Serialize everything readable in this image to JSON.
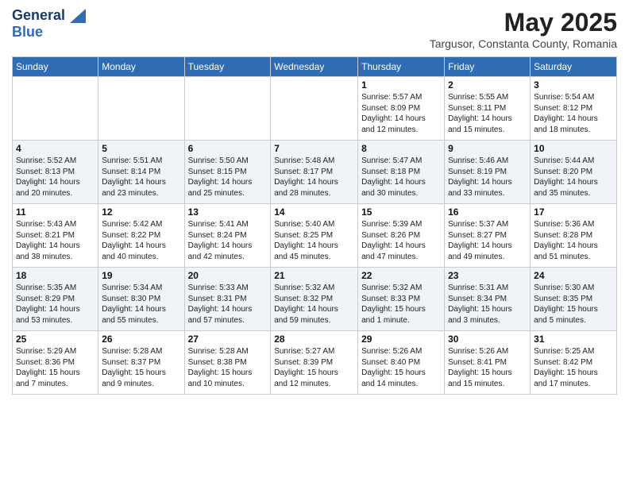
{
  "header": {
    "logo_line1": "General",
    "logo_line2": "Blue",
    "month_title": "May 2025",
    "location": "Targusor, Constanta County, Romania"
  },
  "days_of_week": [
    "Sunday",
    "Monday",
    "Tuesday",
    "Wednesday",
    "Thursday",
    "Friday",
    "Saturday"
  ],
  "weeks": [
    [
      {
        "day": "",
        "info": ""
      },
      {
        "day": "",
        "info": ""
      },
      {
        "day": "",
        "info": ""
      },
      {
        "day": "",
        "info": ""
      },
      {
        "day": "1",
        "info": "Sunrise: 5:57 AM\nSunset: 8:09 PM\nDaylight: 14 hours\nand 12 minutes."
      },
      {
        "day": "2",
        "info": "Sunrise: 5:55 AM\nSunset: 8:11 PM\nDaylight: 14 hours\nand 15 minutes."
      },
      {
        "day": "3",
        "info": "Sunrise: 5:54 AM\nSunset: 8:12 PM\nDaylight: 14 hours\nand 18 minutes."
      }
    ],
    [
      {
        "day": "4",
        "info": "Sunrise: 5:52 AM\nSunset: 8:13 PM\nDaylight: 14 hours\nand 20 minutes."
      },
      {
        "day": "5",
        "info": "Sunrise: 5:51 AM\nSunset: 8:14 PM\nDaylight: 14 hours\nand 23 minutes."
      },
      {
        "day": "6",
        "info": "Sunrise: 5:50 AM\nSunset: 8:15 PM\nDaylight: 14 hours\nand 25 minutes."
      },
      {
        "day": "7",
        "info": "Sunrise: 5:48 AM\nSunset: 8:17 PM\nDaylight: 14 hours\nand 28 minutes."
      },
      {
        "day": "8",
        "info": "Sunrise: 5:47 AM\nSunset: 8:18 PM\nDaylight: 14 hours\nand 30 minutes."
      },
      {
        "day": "9",
        "info": "Sunrise: 5:46 AM\nSunset: 8:19 PM\nDaylight: 14 hours\nand 33 minutes."
      },
      {
        "day": "10",
        "info": "Sunrise: 5:44 AM\nSunset: 8:20 PM\nDaylight: 14 hours\nand 35 minutes."
      }
    ],
    [
      {
        "day": "11",
        "info": "Sunrise: 5:43 AM\nSunset: 8:21 PM\nDaylight: 14 hours\nand 38 minutes."
      },
      {
        "day": "12",
        "info": "Sunrise: 5:42 AM\nSunset: 8:22 PM\nDaylight: 14 hours\nand 40 minutes."
      },
      {
        "day": "13",
        "info": "Sunrise: 5:41 AM\nSunset: 8:24 PM\nDaylight: 14 hours\nand 42 minutes."
      },
      {
        "day": "14",
        "info": "Sunrise: 5:40 AM\nSunset: 8:25 PM\nDaylight: 14 hours\nand 45 minutes."
      },
      {
        "day": "15",
        "info": "Sunrise: 5:39 AM\nSunset: 8:26 PM\nDaylight: 14 hours\nand 47 minutes."
      },
      {
        "day": "16",
        "info": "Sunrise: 5:37 AM\nSunset: 8:27 PM\nDaylight: 14 hours\nand 49 minutes."
      },
      {
        "day": "17",
        "info": "Sunrise: 5:36 AM\nSunset: 8:28 PM\nDaylight: 14 hours\nand 51 minutes."
      }
    ],
    [
      {
        "day": "18",
        "info": "Sunrise: 5:35 AM\nSunset: 8:29 PM\nDaylight: 14 hours\nand 53 minutes."
      },
      {
        "day": "19",
        "info": "Sunrise: 5:34 AM\nSunset: 8:30 PM\nDaylight: 14 hours\nand 55 minutes."
      },
      {
        "day": "20",
        "info": "Sunrise: 5:33 AM\nSunset: 8:31 PM\nDaylight: 14 hours\nand 57 minutes."
      },
      {
        "day": "21",
        "info": "Sunrise: 5:32 AM\nSunset: 8:32 PM\nDaylight: 14 hours\nand 59 minutes."
      },
      {
        "day": "22",
        "info": "Sunrise: 5:32 AM\nSunset: 8:33 PM\nDaylight: 15 hours\nand 1 minute."
      },
      {
        "day": "23",
        "info": "Sunrise: 5:31 AM\nSunset: 8:34 PM\nDaylight: 15 hours\nand 3 minutes."
      },
      {
        "day": "24",
        "info": "Sunrise: 5:30 AM\nSunset: 8:35 PM\nDaylight: 15 hours\nand 5 minutes."
      }
    ],
    [
      {
        "day": "25",
        "info": "Sunrise: 5:29 AM\nSunset: 8:36 PM\nDaylight: 15 hours\nand 7 minutes."
      },
      {
        "day": "26",
        "info": "Sunrise: 5:28 AM\nSunset: 8:37 PM\nDaylight: 15 hours\nand 9 minutes."
      },
      {
        "day": "27",
        "info": "Sunrise: 5:28 AM\nSunset: 8:38 PM\nDaylight: 15 hours\nand 10 minutes."
      },
      {
        "day": "28",
        "info": "Sunrise: 5:27 AM\nSunset: 8:39 PM\nDaylight: 15 hours\nand 12 minutes."
      },
      {
        "day": "29",
        "info": "Sunrise: 5:26 AM\nSunset: 8:40 PM\nDaylight: 15 hours\nand 14 minutes."
      },
      {
        "day": "30",
        "info": "Sunrise: 5:26 AM\nSunset: 8:41 PM\nDaylight: 15 hours\nand 15 minutes."
      },
      {
        "day": "31",
        "info": "Sunrise: 5:25 AM\nSunset: 8:42 PM\nDaylight: 15 hours\nand 17 minutes."
      }
    ]
  ]
}
